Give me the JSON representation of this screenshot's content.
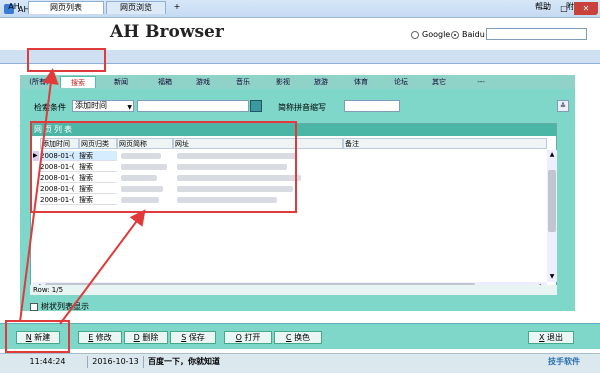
{
  "window": {
    "title": "AH浏览器",
    "min": "—",
    "max": "□",
    "close": "✕"
  },
  "header": {
    "brand": "AH Browser",
    "engines": [
      {
        "label": "Google",
        "selected": false
      },
      {
        "label": "Baidu",
        "selected": true
      }
    ],
    "address_value": ""
  },
  "tabs": {
    "ah": "AH",
    "list": "网页列表",
    "browse": "网页浏览",
    "add": "+",
    "help": "帮助",
    "more": "附"
  },
  "categories": [
    "(所有)",
    "搜索",
    "新闻",
    "福箱",
    "游戏",
    "音乐",
    "影视",
    "旅游",
    "体育",
    "论坛",
    "其它",
    "---"
  ],
  "active_category": "搜索",
  "filter": {
    "label": "检索条件",
    "select_value": "添加时间",
    "pinyin_label": "简称拼音缩写"
  },
  "grid": {
    "title": "网页列表",
    "columns": [
      "添加时间",
      "网页归类",
      "网页简称",
      "网址",
      "备注"
    ],
    "rows": [
      {
        "date": "2008-01-(",
        "category": "搜索"
      },
      {
        "date": "2008-01-(",
        "category": "搜索"
      },
      {
        "date": "2008-01-(",
        "category": "搜索"
      },
      {
        "date": "2008-01-(",
        "category": "搜索"
      },
      {
        "date": "2008-01-(",
        "category": "搜索"
      }
    ],
    "footer": "Row: 1/5"
  },
  "tree_checkbox": "树状列表显示",
  "buttons": [
    {
      "key": "N",
      "label": "新建"
    },
    {
      "key": "E",
      "label": "修改"
    },
    {
      "key": "D",
      "label": "删除"
    },
    {
      "key": "S",
      "label": "保存"
    },
    {
      "key": "O",
      "label": "打开"
    },
    {
      "key": "C",
      "label": "换色"
    },
    {
      "key": "X",
      "label": "退出"
    }
  ],
  "status": {
    "time": "11:44:24",
    "date": "2016-10-13",
    "slogan": "百度一下，你就知道",
    "brand": "技手软件"
  },
  "colors": {
    "panel": "#7fd7c9",
    "annotation": "#e03a3a"
  }
}
